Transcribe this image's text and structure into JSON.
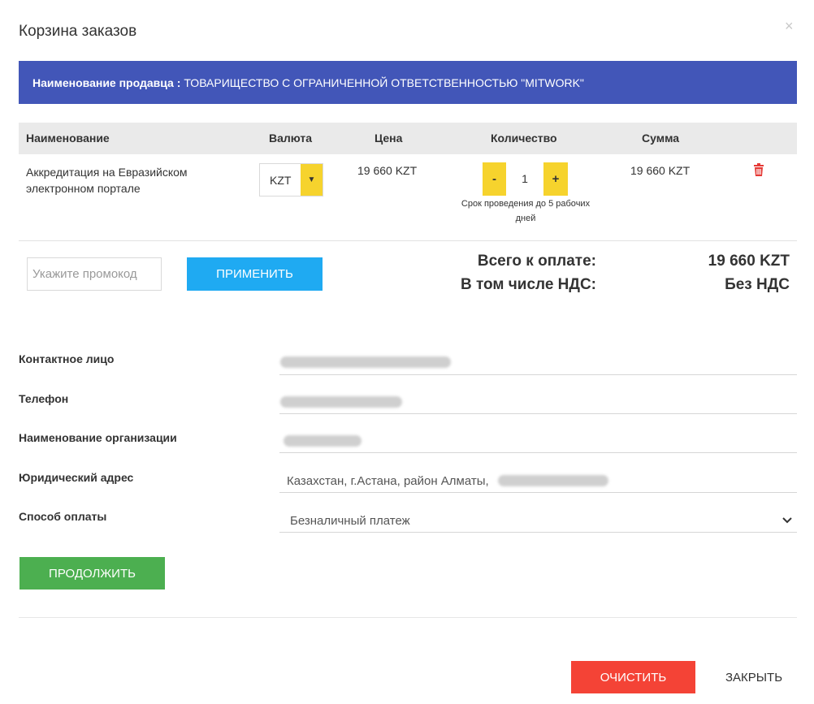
{
  "modal": {
    "title": "Корзина заказов",
    "close_glyph": "×"
  },
  "seller": {
    "label": "Наименование продавца :",
    "name": "ТОВАРИЩЕСТВО С ОГРАНИЧЕННОЙ ОТВЕТСТВЕННОСТЬЮ \"MITWORK\""
  },
  "table": {
    "headers": {
      "name": "Наименование",
      "currency": "Валюта",
      "price": "Цена",
      "quantity": "Количество",
      "sum": "Сумма"
    },
    "rows": [
      {
        "name": "Аккредитация на Евразийском электронном портале",
        "currency": "KZT",
        "price": "19 660 KZT",
        "quantity": "1",
        "minus": "-",
        "plus": "+",
        "note": "Срок проведения до 5 рабочих дней",
        "sum": "19 660 KZT"
      }
    ]
  },
  "promo": {
    "placeholder": "Укажите промокод",
    "apply_label": "ПРИМЕНИТЬ"
  },
  "totals": {
    "total_label": "Всего к оплате:",
    "total_value": "19 660 KZT",
    "vat_label": "В том числе НДС:",
    "vat_value": "Без НДС"
  },
  "form": {
    "contact_label": "Контактное лицо",
    "phone_label": "Телефон",
    "org_label": "Наименование организации",
    "address_label": "Юридический адрес",
    "address_value": "Казахстан, г.Астана, район Алматы,",
    "payment_label": "Способ оплаты",
    "payment_value": "Безналичный платеж"
  },
  "actions": {
    "continue_label": "ПРОДОЛЖИТЬ",
    "clear_label": "ОЧИСТИТЬ",
    "close_label": "ЗАКРЫТЬ"
  },
  "icons": {
    "close": "close-icon",
    "dropdown": "caret-down-icon",
    "trash": "trash-icon",
    "chevron": "chevron-down-icon"
  },
  "colors": {
    "seller_bar": "#4256b8",
    "accent_yellow": "#f6d32d",
    "apply_blue": "#1faaf2",
    "continue_green": "#4caf50",
    "clear_red": "#f44336",
    "trash_red": "#e53935"
  }
}
